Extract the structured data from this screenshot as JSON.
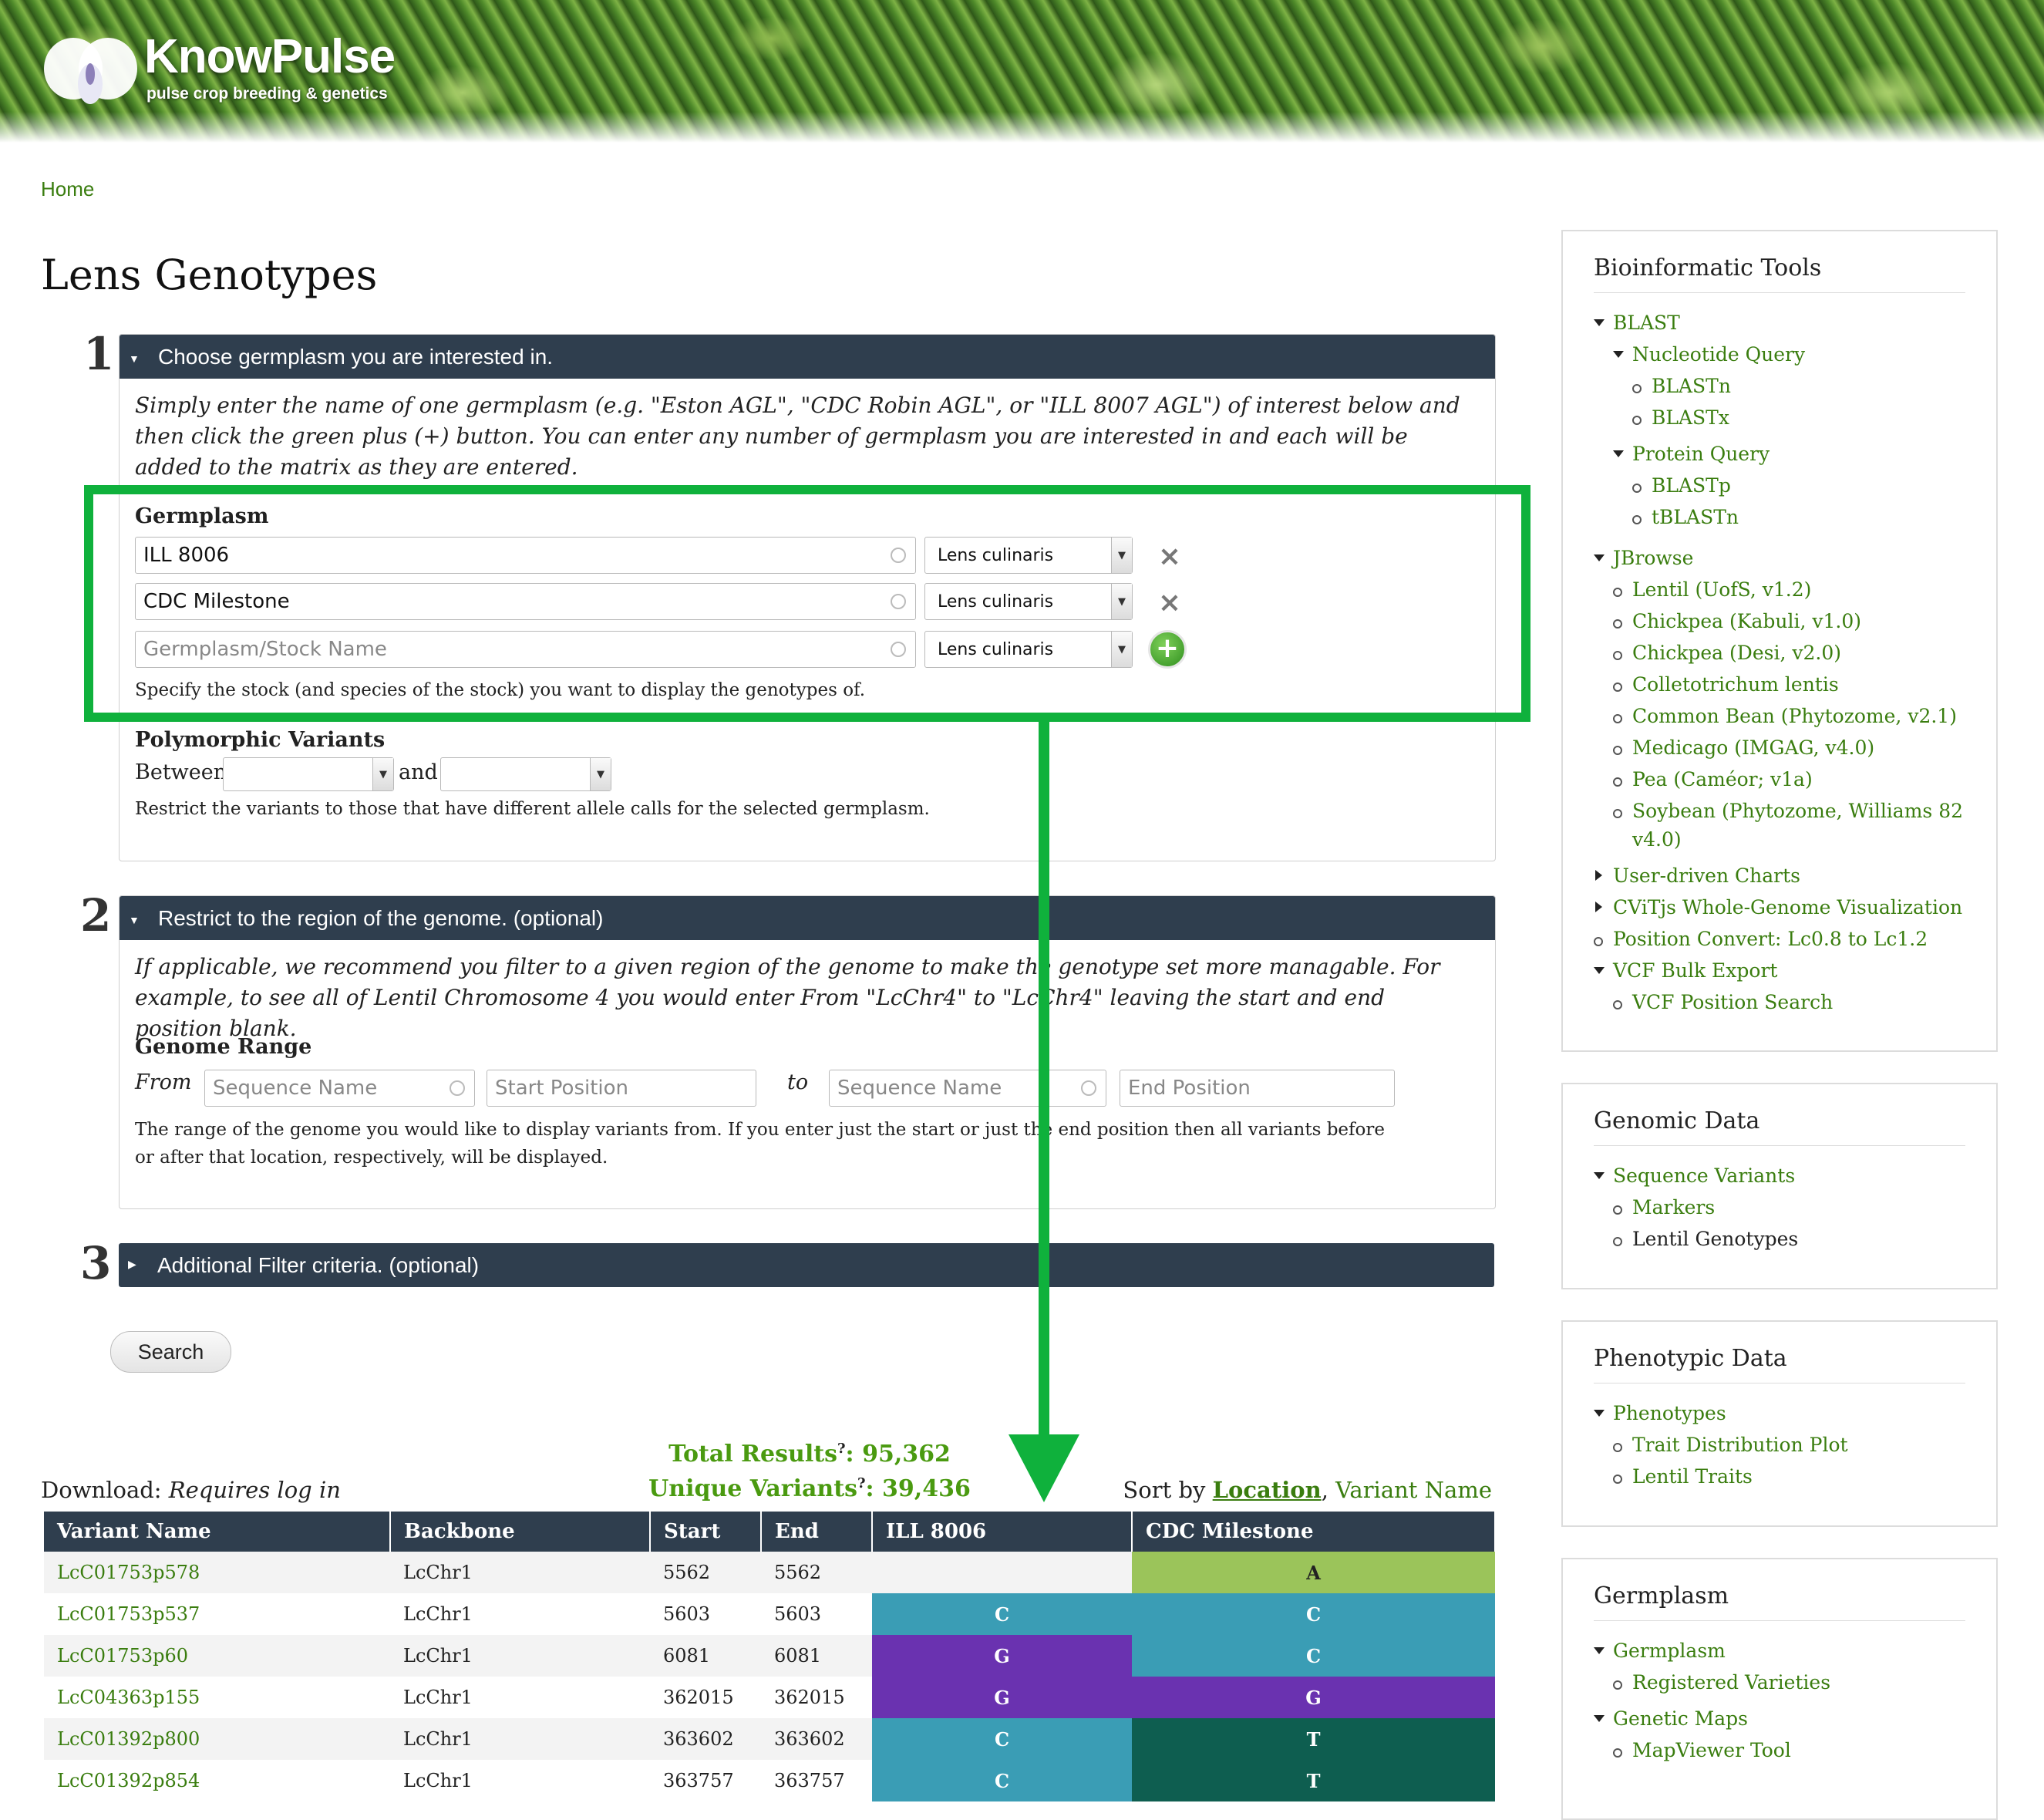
{
  "site": {
    "name": "KnowPulse",
    "tagline": "pulse crop breeding & genetics"
  },
  "breadcrumb": "Home",
  "page_title": "Lens Genotypes",
  "step1": {
    "number": "1",
    "header": "Choose germplasm you are interested in.",
    "description": "Simply enter the name of one germplasm (e.g. \"Eston AGL\", \"CDC Robin AGL\", or \"ILL 8007 AGL\") of interest below and then click the green plus (+) button. You can enter any number of germplasm you are interested in and each will be added to the matrix as they are entered.",
    "germplasm_label": "Germplasm",
    "rows": [
      {
        "value": "ILL 8006",
        "species": "Lens culinaris"
      },
      {
        "value": "CDC Milestone",
        "species": "Lens culinaris"
      }
    ],
    "new_row": {
      "placeholder": "Germplasm/Stock Name",
      "species": "Lens culinaris"
    },
    "germplasm_help": "Specify the stock (and species of the stock) you want to display the genotypes of.",
    "poly_label": "Polymorphic Variants",
    "between": "Between",
    "and": "and",
    "poly_help": "Restrict the variants to those that have different allele calls for the selected germplasm."
  },
  "step2": {
    "number": "2",
    "header": "Restrict to the region of the genome. (optional)",
    "description": "If applicable, we recommend you filter to a given region of the genome to make the genotype set more managable. For example, to see all of Lentil Chromosome 4 you would enter From \"LcChr4\" to \"LcChr4\" leaving the start and end position blank.",
    "range_label": "Genome Range",
    "from": "From",
    "to": "to",
    "seq_placeholder": "Sequence Name",
    "start_placeholder": "Start Position",
    "end_placeholder": "End Position",
    "help": "The range of the genome you would like to display variants from. If you enter just the start or just the end position then all variants before or after that location, respectively, will be displayed."
  },
  "step3": {
    "number": "3",
    "header": "Additional Filter criteria. (optional)"
  },
  "search_button": "Search",
  "results": {
    "total_label": "Total Results",
    "total_value": "95,362",
    "unique_label": "Unique Variants",
    "unique_value": "39,436",
    "help_mark": "?",
    "download_label": "Download:",
    "download_note": "Requires log in",
    "sort_label": "Sort by",
    "sort_location": "Location",
    "sort_variant": "Variant Name",
    "columns": [
      "Variant Name",
      "Backbone",
      "Start",
      "End",
      "ILL 8006",
      "CDC Milestone"
    ],
    "rows": [
      {
        "name": "LcC01753p578",
        "backbone": "LcChr1",
        "start": "5562",
        "end": "5562",
        "a1": "",
        "a2": "A",
        "c1": "",
        "c2": "#9bc45a"
      },
      {
        "name": "LcC01753p537",
        "backbone": "LcChr1",
        "start": "5603",
        "end": "5603",
        "a1": "C",
        "a2": "C",
        "c1": "#3a9db5",
        "c2": "#3a9db5"
      },
      {
        "name": "LcC01753p60",
        "backbone": "LcChr1",
        "start": "6081",
        "end": "6081",
        "a1": "G",
        "a2": "C",
        "c1": "#6a32b0",
        "c2": "#3a9db5"
      },
      {
        "name": "LcC04363p155",
        "backbone": "LcChr1",
        "start": "362015",
        "end": "362015",
        "a1": "G",
        "a2": "G",
        "c1": "#6a32b0",
        "c2": "#6a32b0"
      },
      {
        "name": "LcC01392p800",
        "backbone": "LcChr1",
        "start": "363602",
        "end": "363602",
        "a1": "C",
        "a2": "T",
        "c1": "#3a9db5",
        "c2": "#0e5e50"
      },
      {
        "name": "LcC01392p854",
        "backbone": "LcChr1",
        "start": "363757",
        "end": "363757",
        "a1": "C",
        "a2": "T",
        "c1": "#3a9db5",
        "c2": "#0e5e50"
      }
    ]
  },
  "sidebar": {
    "bioinformatic_tools": {
      "title": "Bioinformatic Tools",
      "items": [
        "BLAST",
        "Nucleotide Query",
        "BLASTn",
        "BLASTx",
        "Protein Query",
        "BLASTp",
        "tBLASTn",
        "JBrowse",
        "Lentil (UofS, v1.2)",
        "Chickpea (Kabuli, v1.0)",
        "Chickpea (Desi, v2.0)",
        "Colletotrichum lentis",
        "Common Bean (Phytozome, v2.1)",
        "Medicago (IMGAG, v4.0)",
        "Pea (Caméor; v1a)",
        "Soybean (Phytozome, Williams 82 v4.0)",
        "User-driven Charts",
        "CViTjs Whole-Genome Visualization",
        "Position Convert: Lc0.8 to Lc1.2",
        "VCF Bulk Export",
        "VCF Position Search"
      ]
    },
    "genomic_data": {
      "title": "Genomic Data",
      "items": [
        "Sequence Variants",
        "Markers",
        "Lentil Genotypes"
      ]
    },
    "phenotypic_data": {
      "title": "Phenotypic Data",
      "items": [
        "Phenotypes",
        "Trait Distribution Plot",
        "Lentil Traits"
      ]
    },
    "germplasm": {
      "title": "Germplasm",
      "items": [
        "Germplasm",
        "Registered Varieties",
        "Genetic Maps",
        "MapViewer Tool"
      ]
    }
  },
  "colors": {
    "highlight": "#0fb13c",
    "header_bg": "#2f3e4e",
    "link": "#3a7d0f"
  }
}
